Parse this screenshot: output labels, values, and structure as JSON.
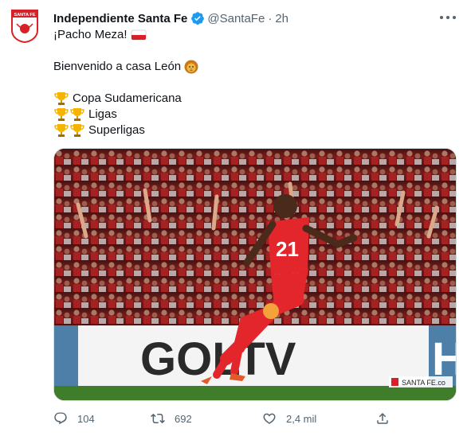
{
  "tweet": {
    "display_name": "Independiente Santa Fe",
    "handle": "@SantaFe",
    "separator": "·",
    "time": "2h",
    "avatar_text": "SANTA FE",
    "verified_icon": "verified-badge-icon",
    "lines": {
      "line1": "¡Pacho Meza! ",
      "line2": "Bienvenido a casa León ",
      "line3": "Copa Sudamericana",
      "line4": "Ligas",
      "line5": "Superligas"
    },
    "emoji": {
      "flag": "flag-icon",
      "lion": "lion-face-icon",
      "trophy": "trophy-icon"
    }
  },
  "media": {
    "jersey_number": "21",
    "sponsor_text": "GOLTV",
    "sponsor_text_right": "H",
    "watermark": "SANTA FE.co",
    "colors": {
      "jersey": "#e3262b",
      "crowd_bg": "#7a1a1a",
      "banner": "#ffffff"
    }
  },
  "actions": {
    "reply_count": "104",
    "retweet_count": "692",
    "like_count": "2,4 mil",
    "share_label": ""
  },
  "colors": {
    "accent": "#1d9bf0",
    "muted": "#536471",
    "text": "#0f1419"
  }
}
